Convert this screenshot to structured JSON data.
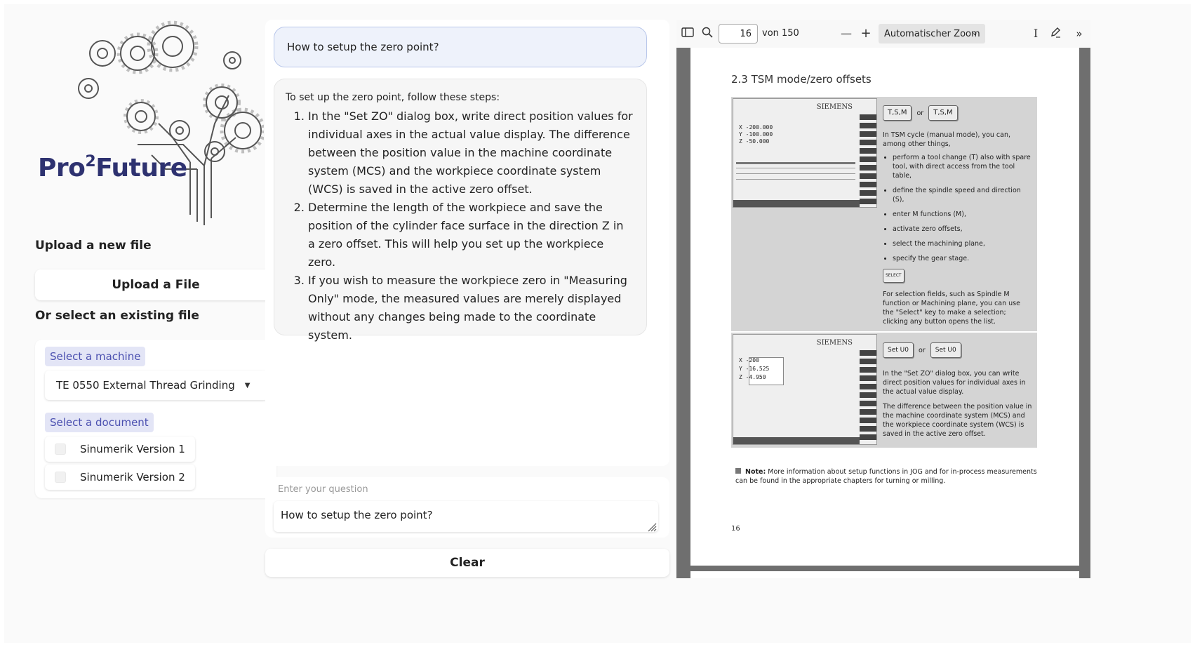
{
  "logo": {
    "brand": "Pro",
    "sup": "2",
    "brand_suffix": "Future"
  },
  "sidebar": {
    "upload_heading": "Upload a new file",
    "upload_button": "Upload a File",
    "existing_heading": "Or select an existing file",
    "machine_label": "Select a machine",
    "machine_selected": "TE 0550 External Thread Grinding",
    "document_label": "Select a document",
    "documents": [
      {
        "label": "Sinumerik Version 1",
        "checked": false
      },
      {
        "label": "Sinumerik Version 2",
        "checked": false
      }
    ]
  },
  "chat": {
    "user_message": "How to setup the zero point?",
    "bot_intro": "To set up the zero point, follow these steps:",
    "bot_steps": [
      "In the \"Set ZO\" dialog box, write direct position values for individual axes in the actual value display. The difference between the position value in the machine coordinate system (MCS) and the workpiece coordinate system (WCS) is saved in the active zero offset.",
      "Determine the length of the workpiece and save the position of the cylinder face surface in the direction Z in a zero offset. This will help you set up the workpiece zero.",
      "If you wish to measure the workpiece zero in \"Measuring Only\" mode, the measured values are merely displayed without any changes being made to the coordinate system."
    ]
  },
  "composer": {
    "label": "Enter your question",
    "value": "How to setup the zero point?"
  },
  "clear_button": "Clear",
  "pdf": {
    "page_current": "16",
    "page_total_label": "von 150",
    "zoom": "Automatischer Zoom",
    "heading": "2.3  TSM mode/zero offsets",
    "screen_brand": "SIEMENS",
    "row1": {
      "key_a": "T,S,M",
      "or": "or",
      "key_b": "T,S,M",
      "intro": "In TSM cycle (manual mode), you can, among other things,",
      "bullets": [
        "perform a tool change (T) also with spare tool, with direct access from the tool table,",
        "define the spindle speed and direction (S),",
        "enter M functions (M),",
        "activate zero offsets,",
        "select the machining plane,",
        "specify the gear stage."
      ],
      "select_key": "SELECT",
      "select_text": "For selection fields, such as Spindle M function or Machining plane, you can use the \"Select\" key to make a selection; clicking any button opens the list."
    },
    "row2": {
      "key_a": "Set U0",
      "or": "or",
      "key_b": "Set U0",
      "text1": "In the \"Set ZO\" dialog box, you can write direct position values for individual axes in the actual value display.",
      "text2": "The difference between the position value in the machine coordinate system (MCS) and the workpiece coordinate system (WCS) is saved in the active zero offset."
    },
    "screen1_values": [
      "X  -200.000",
      "Y  -100.000",
      "Z   -50.000"
    ],
    "screen2_values": [
      "X  -200",
      "Y  -16.525",
      "Z  -4.950"
    ],
    "note_label": "Note:",
    "note_text": "More information about setup functions in JOG and for in-process measurements can be found in the appropriate chapters for turning or milling.",
    "page_number": "16"
  },
  "colors": {
    "brand": "#2e3270",
    "tag_bg": "#e3e5f6",
    "tag_text": "#4b50b0",
    "user_bubble": "#eef2fb",
    "user_border": "#b9c7ea"
  }
}
